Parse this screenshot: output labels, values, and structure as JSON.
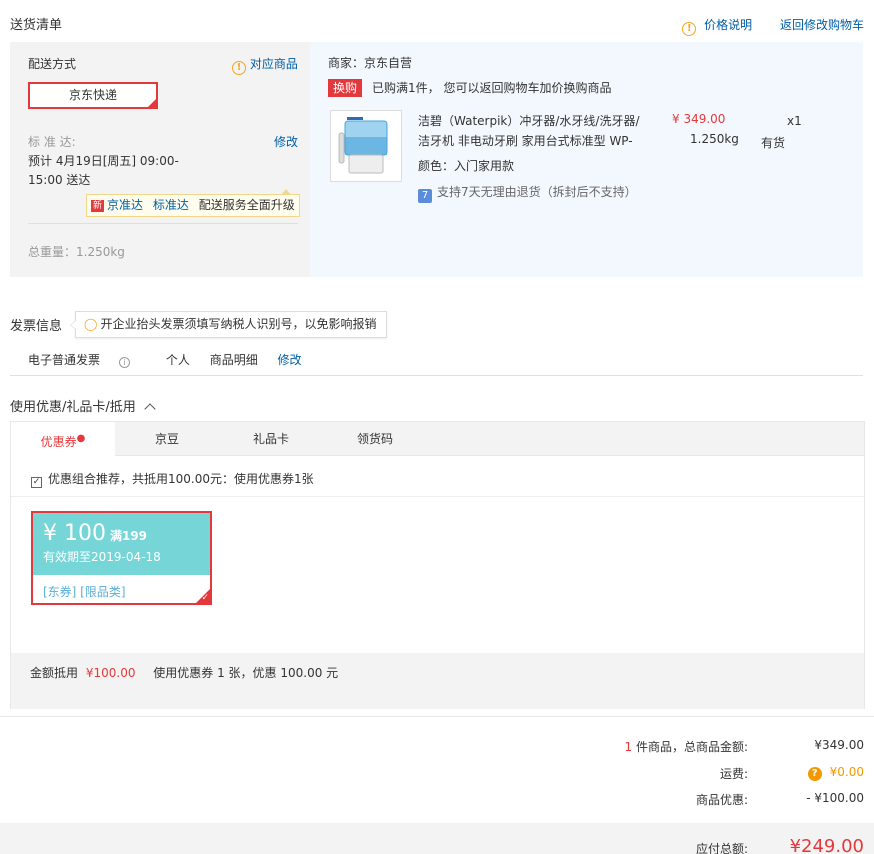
{
  "shipping": {
    "section_title": "送货清单",
    "price_note": "价格说明",
    "back_to_cart": "返回修改购物车",
    "method_label": "配送方式",
    "match_goods": "对应商品",
    "express_option": "京东快递",
    "std_label": "标 准 达:",
    "modify": "修改",
    "estimate_line1": "预计 4月19日[周五] 09:00-",
    "estimate_line2": "15:00 送达",
    "tip_new": "新",
    "tip_jzd": "京准达",
    "tip_bzd": "标准达",
    "tip_text": "配送服务全面升级",
    "total_weight": "总重量：1.250kg"
  },
  "goods": {
    "seller": "商家：京东自营",
    "swap_tag": "换购",
    "swap_text": "已购满1件， 您可以返回购物车加价换购商品",
    "name_line1": "洁碧（Waterpik）冲牙器/水牙线/洗牙器/",
    "name_line2": "洁牙机 非电动牙刷 家用台式标准型 WP-",
    "price": "¥ 349.00",
    "weight": "1.250kg",
    "qty": "x1",
    "stock": "有货",
    "color": "颜色：入门家用款",
    "support_text": "支持7天无理由退货（拆封后不支持）"
  },
  "invoice": {
    "label": "发票信息",
    "tip": "开企业抬头发票须填写纳税人识别号，以免影响报销",
    "type": "电子普通发票",
    "title": "个人",
    "content": "商品明细",
    "modify": "修改"
  },
  "coupon": {
    "section_title": "使用优惠/礼品卡/抵用",
    "tabs": [
      "优惠券",
      "京豆",
      "礼品卡",
      "领货码"
    ],
    "combo_text": "优惠组合推荐，共抵用100.00元：使用优惠券1张",
    "card_amount": "¥ 100",
    "card_condition": "满199",
    "card_date": "有效期至2019-04-18",
    "card_tags": "[东券]  [限品类]",
    "summary_label": "金额抵用",
    "summary_amount": "¥100.00",
    "summary_text": "使用优惠券 1 张，优惠 100.00 元"
  },
  "totals": {
    "count": "1",
    "count_label": "件商品，总商品金额:",
    "goods_amount": "¥349.00",
    "freight_label": "运费:",
    "freight": "¥0.00",
    "discount_label": "商品优惠:",
    "discount": "- ¥100.00",
    "payable_label": "应付总额:",
    "payable": "¥249.00"
  }
}
